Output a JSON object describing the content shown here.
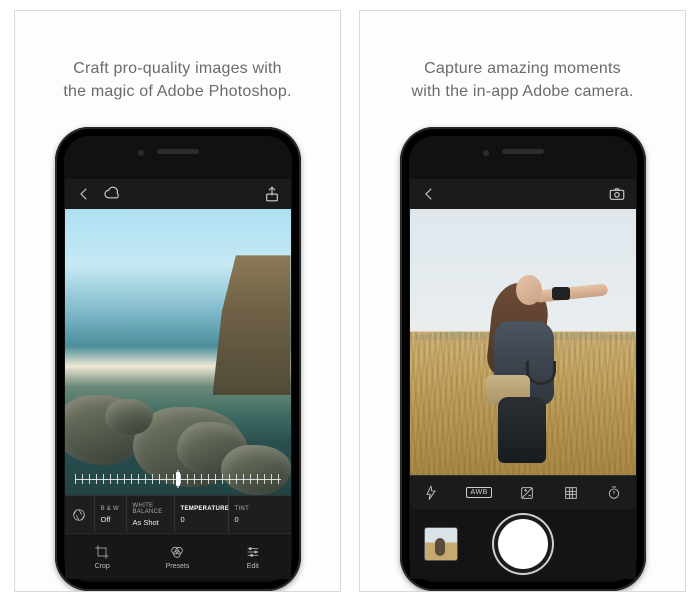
{
  "left": {
    "tagline_l1": "Craft pro-quality images with",
    "tagline_l2": "the magic of Adobe Photoshop.",
    "settings": {
      "bw_label": "B & W",
      "bw_value": "Off",
      "wb_label": "WHITE BALANCE",
      "wb_value": "As Shot",
      "temp_label": "TEMPERATURE",
      "temp_value": "0",
      "tint_label": "TINT",
      "tint_value": "0"
    },
    "tabs": {
      "crop": "Crop",
      "presets": "Presets",
      "edit": "Edit"
    }
  },
  "right": {
    "tagline_l1": "Capture amazing moments",
    "tagline_l2": "with the in-app Adobe camera.",
    "awb_label": "AWB"
  }
}
